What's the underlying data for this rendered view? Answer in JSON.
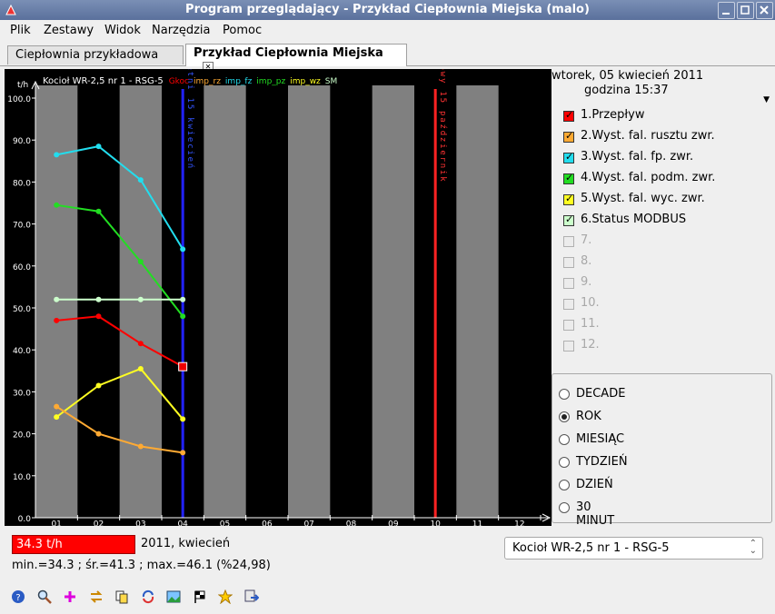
{
  "window": {
    "title": "Program przeglądający - Przykład Ciepłownia Miejska (malo)"
  },
  "menu": [
    "Plik",
    "Zestawy",
    "Widok",
    "Narzędzia",
    "Pomoc"
  ],
  "tabs": [
    {
      "label": "Ciepłownia przykładowa",
      "active": false
    },
    {
      "label": "Przykład Ciepłownia Miejska",
      "active": true
    }
  ],
  "header": {
    "date": "wtorek, 05 kwiecień 2011",
    "time": "godzina 15:37"
  },
  "chart_data": {
    "type": "line",
    "title": "Kocioł WR-2,5 nr 1 - RSG-5",
    "ylabel": "t/h",
    "ylim": [
      0,
      100
    ],
    "yticks": [
      "0.0",
      "10.0",
      "20.0",
      "30.0",
      "40.0",
      "50.0",
      "60.0",
      "70.0",
      "80.0",
      "90.0",
      "100.0"
    ],
    "categories": [
      "01",
      "02",
      "03",
      "04",
      "05",
      "06",
      "07",
      "08",
      "09",
      "10",
      "11",
      "12"
    ],
    "legend_labels": [
      {
        "text": "Gkoc",
        "color": "#ff0000"
      },
      {
        "text": "imp_rz",
        "color": "#ffaa33"
      },
      {
        "text": "imp_fz",
        "color": "#22ddee"
      },
      {
        "text": "imp_pz",
        "color": "#22dd22"
      },
      {
        "text": "imp_wz",
        "color": "#ffff22"
      },
      {
        "text": "SM",
        "color": "#ccffcc"
      }
    ],
    "series": [
      {
        "name": "imp_fz",
        "color": "#22ddee",
        "values": [
          86.5,
          88.5,
          80.5,
          64.0
        ]
      },
      {
        "name": "imp_pz",
        "color": "#22dd22",
        "values": [
          74.5,
          73.0,
          61.0,
          48.0
        ]
      },
      {
        "name": "SM",
        "color": "#ccffcc",
        "values": [
          52.0,
          52.0,
          52.0,
          52.0
        ]
      },
      {
        "name": "Gkoc",
        "color": "#ff0000",
        "values": [
          47.0,
          48.0,
          41.5,
          36.0
        ]
      },
      {
        "name": "imp_wz",
        "color": "#ffff22",
        "values": [
          24.0,
          31.5,
          35.5,
          23.5
        ]
      },
      {
        "name": "imp_rz",
        "color": "#ffaa33",
        "values": [
          26.5,
          20.0,
          17.0,
          15.5
        ]
      }
    ],
    "markers": [
      {
        "label": "sezon letni 15 kwiecień",
        "color": "#2222ff",
        "text_color": "#3355ff",
        "x": 3.5
      },
      {
        "label": "sezon zimowy 15 październik",
        "color": "#ff2222",
        "text_color": "#ff3333",
        "x": 9.5
      }
    ]
  },
  "legend": [
    {
      "label": "1.Przepływ",
      "color": "#ff0000",
      "checked": true
    },
    {
      "label": "2.Wyst. fal. rusztu zwr.",
      "color": "#ffaa33",
      "checked": true
    },
    {
      "label": "3.Wyst. fal. fp. zwr.",
      "color": "#22ddee",
      "checked": true
    },
    {
      "label": "4.Wyst. fal. podm. zwr.",
      "color": "#22dd22",
      "checked": true
    },
    {
      "label": "5.Wyst. fal. wyc. zwr.",
      "color": "#ffff22",
      "checked": true
    },
    {
      "label": "6.Status MODBUS",
      "color": "#ccffcc",
      "checked": true
    },
    {
      "label": "7.",
      "color": "",
      "checked": false
    },
    {
      "label": "8.",
      "color": "",
      "checked": false
    },
    {
      "label": "9.",
      "color": "",
      "checked": false
    },
    {
      "label": "10.",
      "color": "",
      "checked": false
    },
    {
      "label": "11.",
      "color": "",
      "checked": false
    },
    {
      "label": "12.",
      "color": "",
      "checked": false
    }
  ],
  "period_options": [
    {
      "label": "DECADE",
      "selected": false
    },
    {
      "label": "ROK",
      "selected": true
    },
    {
      "label": "MIESIĄC",
      "selected": false
    },
    {
      "label": "TYDZIEŃ",
      "selected": false
    },
    {
      "label": "DZIEŃ",
      "selected": false
    },
    {
      "label": "30 MINUT",
      "selected": false
    }
  ],
  "status": {
    "value": "34.3 t/h",
    "period": "2011, kwiecień",
    "stats": "min.=34.3 ; śr.=41.3 ; max.=46.1  (%24,98)"
  },
  "device_select": {
    "value": "Kocioł WR-2,5 nr 1 - RSG-5"
  },
  "toolbar": [
    "help-icon",
    "zoom-icon",
    "add-icon",
    "swap-icon",
    "copy-icon",
    "refresh-icon",
    "image-icon",
    "flag-icon",
    "star-icon",
    "export-icon"
  ]
}
